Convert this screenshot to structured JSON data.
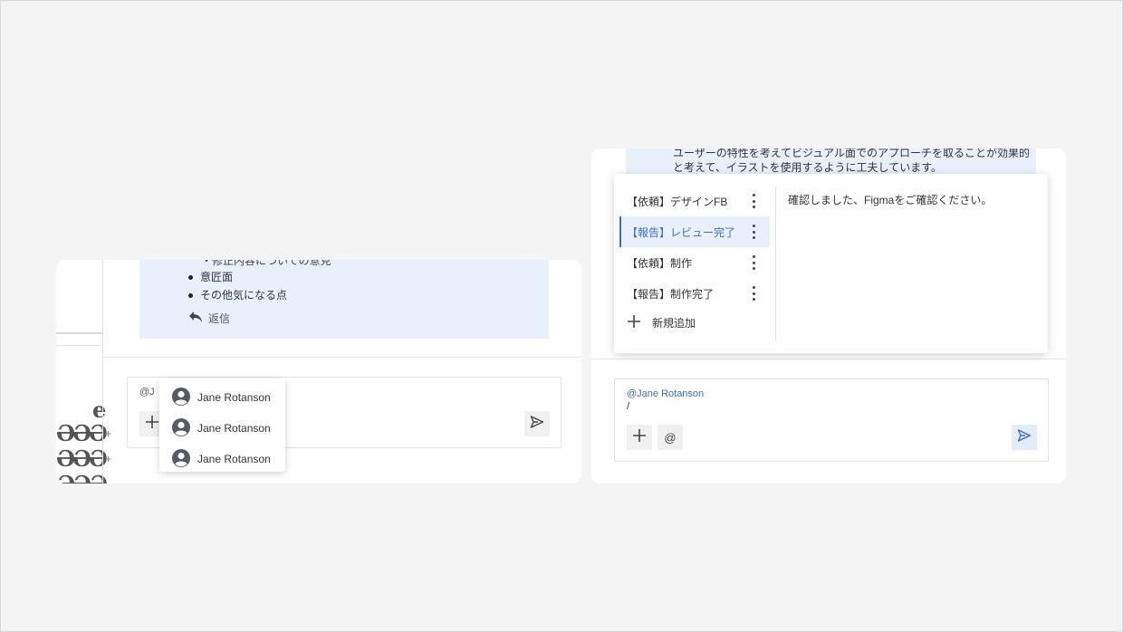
{
  "left_panel": {
    "message": {
      "bullets_cut_text": "・修正内容についての意見",
      "bullets": [
        "意匠面",
        "その他気になる点"
      ],
      "reply_label": "返信"
    },
    "sidebar_garbled": [
      "e",
      "ƏƏƏ",
      "ƏƏƏ",
      "ƏƏƏ"
    ],
    "composer": {
      "typed_text": "@J"
    },
    "mention_dropdown": {
      "users": [
        "Jane Rotanson",
        "Jane Rotanson",
        "Jane Rotanson"
      ]
    }
  },
  "right_panel": {
    "message": {
      "text": "ユーザーの特性を考えてビジュアル面でのアプローチを取ることが効果的と考えて、イラストを使用するように工夫しています。"
    },
    "template_menu": {
      "items": [
        {
          "label": "【依頼】デザインFB",
          "active": false
        },
        {
          "label": "【報告】レビュー完了",
          "active": true
        },
        {
          "label": "【依頼】制作",
          "active": false
        },
        {
          "label": "【報告】制作完了",
          "active": false
        }
      ],
      "add_label": "新規追加",
      "preview_text": "確認しました、Figmaをご確認ください。"
    },
    "composer": {
      "mention": "@Jane Rotanson",
      "text": "/",
      "at_symbol": "@"
    }
  },
  "colors": {
    "accent": "#3a6fc4",
    "message_bg": "#e8f0fc",
    "page_bg": "#f4f4f4"
  },
  "icons": [
    "reply-icon",
    "plus-icon",
    "send-icon",
    "user-avatar-icon",
    "kebab-icon",
    "at-icon"
  ]
}
